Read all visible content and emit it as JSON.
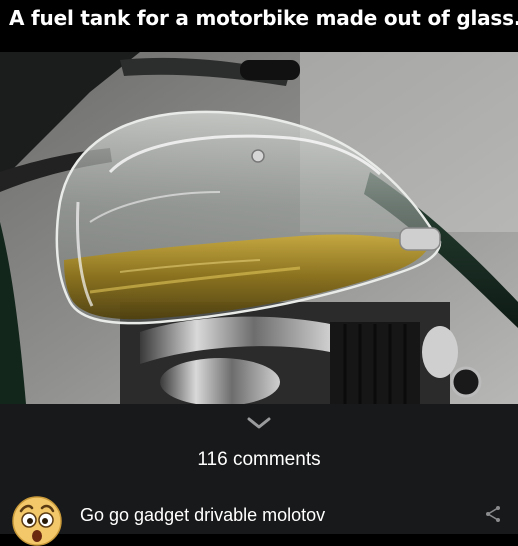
{
  "caption": {
    "text": "A fuel tank for a motorbike made out of glass..."
  },
  "photo": {
    "subject": "glass motorbike fuel tank filled with fuel"
  },
  "comments": {
    "count_label": "116 comments",
    "expand_icon": "chevron-down-icon"
  },
  "first_comment": {
    "avatar_icon": "surprised-emoji-avatar",
    "text": "Go go gadget drivable molotov",
    "action_icon": "share-icon"
  },
  "colors": {
    "background": "#000000",
    "panel": "#18191a",
    "text": "#ffffff",
    "fuel": "#a8891e"
  }
}
